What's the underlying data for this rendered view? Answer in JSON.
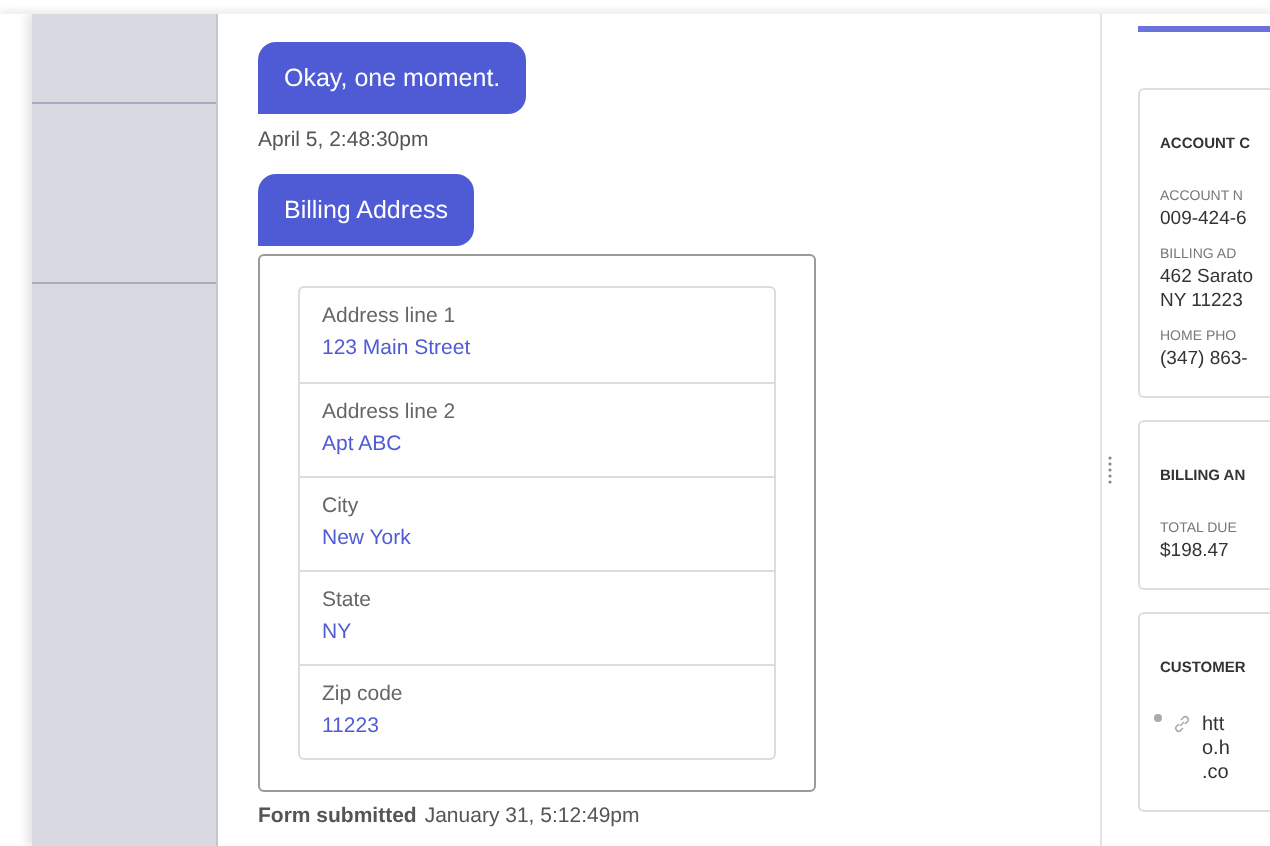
{
  "chat": {
    "messages": [
      {
        "kind": "bubble",
        "text": "Okay, one moment.",
        "time": "April 5, 2:48:30pm"
      },
      {
        "kind": "form",
        "text": "Billing Address",
        "fields": [
          {
            "label": "Address line 1",
            "value": "123 Main Street"
          },
          {
            "label": "Address line 2",
            "value": "Apt ABC"
          },
          {
            "label": "City",
            "value": "New York"
          },
          {
            "label": "State",
            "value": "NY"
          },
          {
            "label": "Zip code",
            "value": "11223"
          }
        ],
        "status": "Form submitted",
        "time": "January 31, 5:12:49pm"
      }
    ]
  },
  "panel": {
    "cards": [
      {
        "title": "ACCOUNT C",
        "items": [
          {
            "label": "ACCOUNT N",
            "lines": [
              "009-424-6"
            ]
          },
          {
            "label": "BILLING AD",
            "lines": [
              "462 Sarato",
              "NY 11223"
            ]
          },
          {
            "label": "HOME PHO",
            "lines": [
              "(347) 863-"
            ]
          }
        ]
      },
      {
        "title": "BILLING AN",
        "items": [
          {
            "label": "TOTAL DUE",
            "lines": [
              "$198.47"
            ]
          }
        ]
      },
      {
        "title": "CUSTOMER",
        "links": [
          {
            "lines": [
              "htt",
              "o.h",
              ".co"
            ]
          }
        ]
      }
    ]
  }
}
